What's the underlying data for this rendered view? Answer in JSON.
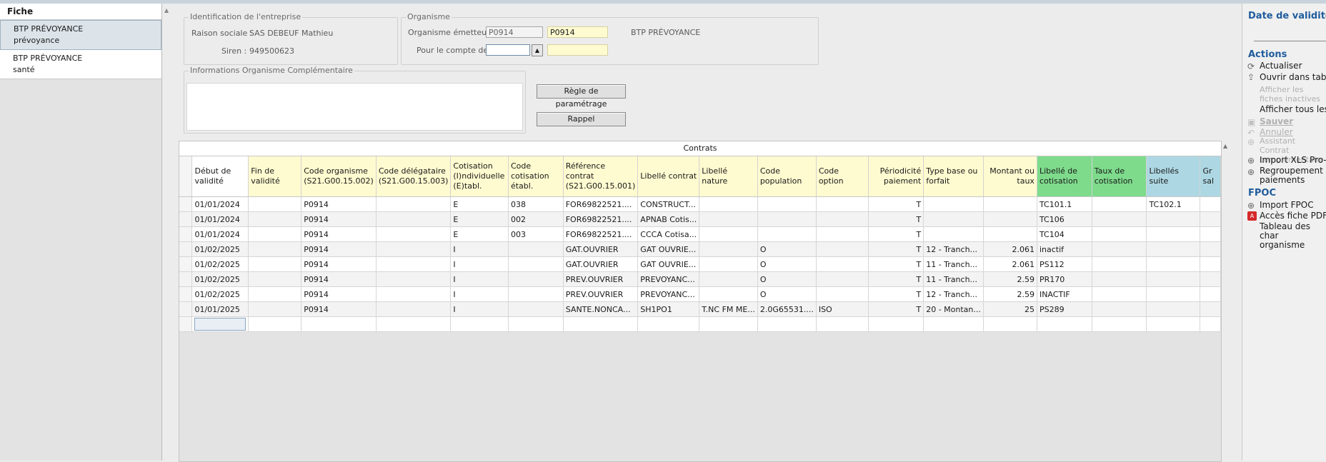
{
  "left_panel": {
    "header": "Fiche",
    "items": [
      {
        "line1": "BTP PRÉVOYANCE",
        "line2": "prévoyance"
      },
      {
        "line1": "BTP PRÉVOYANCE",
        "line2": "santé"
      }
    ]
  },
  "identification": {
    "legend": "Identification de l'entreprise",
    "raison_label": "Raison sociale :",
    "raison_value": "SAS DEBEUF Mathieu",
    "siren_label": "Siren :",
    "siren_value": "949500623"
  },
  "organisme": {
    "legend": "Organisme",
    "emetteur_label": "Organisme émetteur :",
    "emetteur_code": "P0914",
    "emetteur_code2": "P0914",
    "emetteur_name": "BTP PRÉVOYANCE",
    "compte_label": "Pour le compte de :",
    "compte_value": "",
    "compte_value2": ""
  },
  "info_comp": {
    "legend": "Informations Organisme Complémentaire",
    "text": ""
  },
  "buttons": {
    "regle": "Règle de paramétrage",
    "rappel": "Rappel"
  },
  "grid": {
    "title": "Contrats",
    "columns": [
      {
        "label": "Début de validité",
        "style": "w"
      },
      {
        "label": "Fin de validité",
        "style": "y"
      },
      {
        "label": "Code organisme (S21.G00.15.002)",
        "style": "y"
      },
      {
        "label": "Code délégataire (S21.G00.15.003)",
        "style": "y"
      },
      {
        "label": "Cotisation (I)ndividuelle (E)tabl.",
        "style": "y"
      },
      {
        "label": "Code cotisation établ.",
        "style": "y"
      },
      {
        "label": "Référence contrat (S21.G00.15.001)",
        "style": "y"
      },
      {
        "label": "Libellé contrat",
        "style": "y"
      },
      {
        "label": "Libellé nature",
        "style": "y"
      },
      {
        "label": "Code population",
        "style": "y"
      },
      {
        "label": "Code option",
        "style": "y"
      },
      {
        "label": "Périodicité paiement",
        "style": "y r"
      },
      {
        "label": "Type base ou forfait",
        "style": "y"
      },
      {
        "label": "Montant ou taux",
        "style": "y r"
      },
      {
        "label": "Libellé de cotisation",
        "style": "g"
      },
      {
        "label": "Taux de cotisation",
        "style": "g"
      },
      {
        "label": "Libellés suite",
        "style": "b"
      },
      {
        "label": "Gr sal",
        "style": "b"
      }
    ],
    "rows": [
      [
        "01/01/2024",
        "",
        "P0914",
        "",
        "E",
        "038",
        "FOR69822521....",
        "CONSTRUCT...",
        "",
        "",
        "",
        "T",
        "",
        "",
        "TC101.1",
        "",
        "TC102.1",
        ""
      ],
      [
        "01/01/2024",
        "",
        "P0914",
        "",
        "E",
        "002",
        "FOR69822521....",
        "APNAB Cotis...",
        "",
        "",
        "",
        "T",
        "",
        "",
        "TC106",
        "",
        "",
        ""
      ],
      [
        "01/01/2024",
        "",
        "P0914",
        "",
        "E",
        "003",
        "FOR69822521....",
        "CCCA Cotisa...",
        "",
        "",
        "",
        "T",
        "",
        "",
        "TC104",
        "",
        "",
        ""
      ],
      [
        "01/02/2025",
        "",
        "P0914",
        "",
        "I",
        "",
        "GAT.OUVRIER",
        "GAT OUVRIE...",
        "",
        "O",
        "",
        "T",
        "12 - Tranch...",
        "2.061",
        "inactif",
        "",
        "",
        ""
      ],
      [
        "01/02/2025",
        "",
        "P0914",
        "",
        "I",
        "",
        "GAT.OUVRIER",
        "GAT OUVRIE...",
        "",
        "O",
        "",
        "T",
        "11 - Tranch...",
        "2.061",
        "PS112",
        "",
        "",
        ""
      ],
      [
        "01/02/2025",
        "",
        "P0914",
        "",
        "I",
        "",
        "PREV.OUVRIER",
        "PREVOYANC...",
        "",
        "O",
        "",
        "T",
        "11 - Tranch...",
        "2.59",
        "PR170",
        "",
        "",
        ""
      ],
      [
        "01/02/2025",
        "",
        "P0914",
        "",
        "I",
        "",
        "PREV.OUVRIER",
        "PREVOYANC...",
        "",
        "O",
        "",
        "T",
        "12 - Tranch...",
        "2.59",
        "INACTIF",
        "",
        "",
        ""
      ],
      [
        "01/01/2025",
        "",
        "P0914",
        "",
        "I",
        "",
        "SANTE.NONCA...",
        "SH1PO1",
        "T.NC FM ME...",
        "2.0G65531....",
        "ISO",
        "T",
        "20 - Montan...",
        "25",
        "PS289",
        "",
        "",
        ""
      ],
      [
        "",
        "",
        "",
        "",
        "",
        "",
        "",
        "",
        "",
        "",
        "",
        "",
        "",
        "",
        "",
        "",
        "",
        ""
      ]
    ]
  },
  "right_panel": {
    "title": "Date de validité",
    "actions_title": "Actions",
    "actions": [
      {
        "label": "Actualiser",
        "icon": "refresh-icon",
        "disabled": false
      },
      {
        "label": "Ouvrir dans tableu",
        "icon": "export-icon",
        "disabled": false
      },
      {
        "label": "Afficher les fiches inactives",
        "icon": "",
        "disabled": true
      },
      {
        "label": "Afficher tous les c",
        "icon": "",
        "disabled": false
      },
      {
        "label": "Sauver",
        "icon": "save-icon",
        "disabled": true
      },
      {
        "label": "Annuler",
        "icon": "undo-icon",
        "disabled": true
      },
      {
        "label": "Assistant Contrat complémentaire",
        "icon": "plus-icon",
        "disabled": true
      },
      {
        "label": "Import XLS Pro-B",
        "icon": "plus-icon",
        "disabled": false
      },
      {
        "label": "Regroupement paiements",
        "icon": "plus-icon",
        "disabled": false
      }
    ],
    "fpoc_title": "FPOC",
    "fpoc": [
      {
        "label": "Import FPOC",
        "icon": "plus-icon"
      },
      {
        "label": "Accès fiche PDF",
        "icon": "pdf-icon"
      },
      {
        "label": "Tableau des char organisme",
        "icon": ""
      }
    ]
  },
  "colors": {
    "accent": "#1f5c9c",
    "yellow_header": "#fffbd0",
    "green_header": "#7edb8c",
    "blue_header": "#add8e3"
  }
}
